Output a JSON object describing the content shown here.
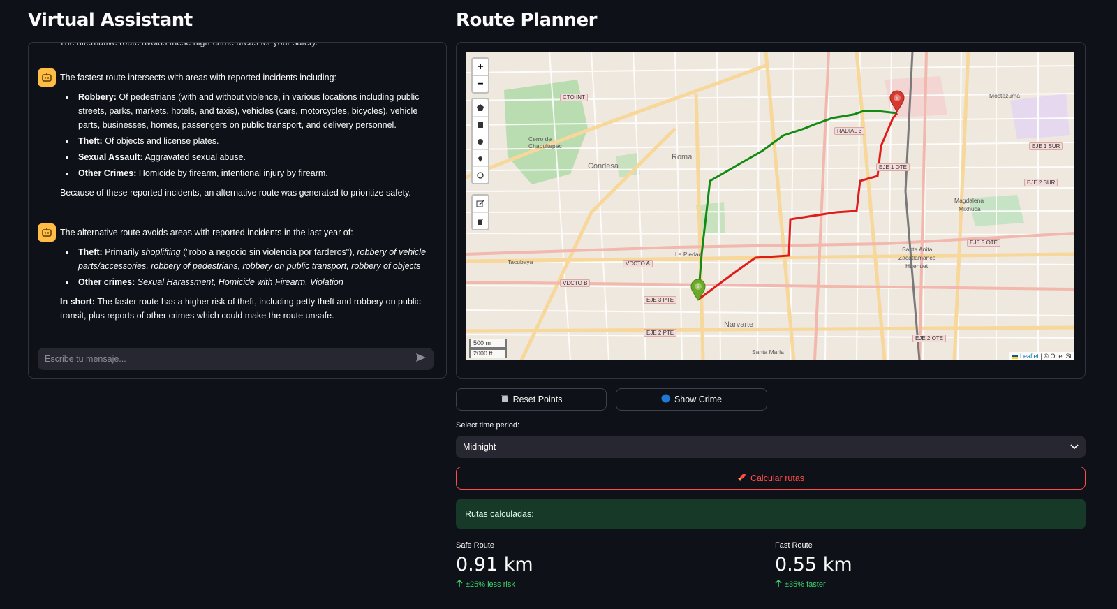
{
  "left": {
    "title": "Virtual Assistant",
    "cut_message": "The alternative route avoids these high-crime areas for your safety.",
    "messages": [
      {
        "intro": "The fastest route intersects with areas with reported incidents including:",
        "items": [
          {
            "label": "Robbery:",
            "text": "Of pedestrians (with and without violence, in various locations including public streets, parks, markets, hotels, and taxis), vehicles (cars, motorcycles, bicycles), vehicle parts, businesses, homes, passengers on public transport, and delivery personnel."
          },
          {
            "label": "Theft:",
            "text": "Of objects and license plates."
          },
          {
            "label": "Sexual Assault:",
            "text": "Aggravated sexual abuse."
          },
          {
            "label": "Other Crimes:",
            "text": "Homicide by firearm, intentional injury by firearm."
          }
        ],
        "outro": "Because of these reported incidents, an alternative route was generated to prioritize safety."
      },
      {
        "intro": "The alternative route avoids areas with reported incidents in the last year of:",
        "theft_label": "Theft:",
        "theft_primarily": "Primarily",
        "theft_shoplifting": "shoplifting",
        "theft_quote": "(\"robo a negocio sin violencia por farderos\"),",
        "theft_rest": "robbery of vehicle parts/accessories, robbery of pedestrians, robbery on public transport, robbery of objects",
        "other_label": "Other crimes:",
        "other_text": "Sexual Harassment, Homicide with Firearm, Violation",
        "short_label": "In short:",
        "short_text": "The faster route has a higher risk of theft, including petty theft and robbery on public transit, plus reports of other crimes which could make the route unsafe."
      }
    ],
    "input_placeholder": "Escribe tu mensaje..."
  },
  "right": {
    "title": "Route Planner",
    "map": {
      "zoom_in": "+",
      "zoom_out": "−",
      "scale_m": "500 m",
      "scale_ft": "2000 ft",
      "attribution_leaflet": "Leaflet",
      "attribution_rest": "| © OpenSt",
      "labels": {
        "roma": "Roma",
        "condesa": "Condesa",
        "narvarte": "Narvarte",
        "tacubaya": "Tacubaya",
        "la_piedad": "La Piedad",
        "santa_anita": "Santa Anita",
        "zacatlamanco": "Zacatlamanco",
        "huehuet": "Huehuet",
        "magdalena": "Magdalena",
        "mixhuca": "Mixhuca",
        "moctezuma": "Moctezuma",
        "santa_maria": "Santa Maria",
        "cerro": "Cerro de Chapultepec"
      },
      "shields": {
        "cto_int": "CTO INT",
        "radial3": "RADIAL 3",
        "eje1ote": "EJE 1 OTE",
        "eje1sur": "EJE 1 SUR",
        "eje2sur": "EJE 2 SUR",
        "eje3ote": "EJE 3 OTE",
        "vdcto_a": "VDCTO A",
        "vdcto_b": "VDCTO B",
        "eje3pte": "EJE 3 PTE",
        "eje2pte": "EJE 2 PTE",
        "eje2ote": "EJE 2 OTE"
      },
      "route_colors": {
        "safe": "#138a13",
        "fast": "#e01b1b"
      }
    },
    "buttons": {
      "reset": "Reset Points",
      "crime": "Show Crime",
      "calc": "Calcular rutas"
    },
    "select": {
      "label": "Select time period:",
      "value": "Midnight"
    },
    "result_title": "Rutas calculadas:",
    "metrics": {
      "safe": {
        "label": "Safe Route",
        "value": "0.91 km",
        "delta": "±25% less risk"
      },
      "fast": {
        "label": "Fast Route",
        "value": "0.55 km",
        "delta": "±35% faster"
      }
    }
  },
  "colors": {
    "background": "#0e1117",
    "accent_red": "#ff4b4b",
    "success_bg": "#173928",
    "delta_green": "#3dd56d",
    "avatar": "#ffbd45"
  }
}
